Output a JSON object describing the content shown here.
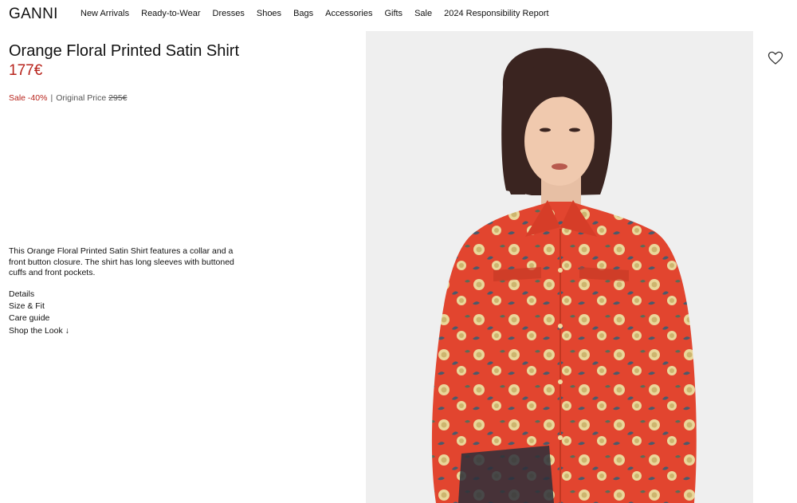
{
  "brand": {
    "logo_text": "GANNI"
  },
  "nav": {
    "items": [
      {
        "label": "New Arrivals"
      },
      {
        "label": "Ready-to-Wear"
      },
      {
        "label": "Dresses"
      },
      {
        "label": "Shoes"
      },
      {
        "label": "Bags"
      },
      {
        "label": "Accessories"
      },
      {
        "label": "Gifts"
      },
      {
        "label": "Sale"
      },
      {
        "label": "2024 Responsibility Report"
      }
    ]
  },
  "product": {
    "title": "Orange Floral Printed Satin Shirt",
    "price": "177€",
    "sale_label": "Sale -40%",
    "separator": "|",
    "original_price_label": "Original Price ",
    "original_price": "295€",
    "description": "This Orange Floral Printed Satin Shirt features a collar and a front button closure. The shirt has long sleeves with buttoned cuffs and front pockets.",
    "links": [
      {
        "label": "Details"
      },
      {
        "label": "Size & Fit"
      },
      {
        "label": "Care guide"
      },
      {
        "label": "Shop the Look ↓"
      }
    ]
  },
  "icons": {
    "wishlist": "heart-outline-icon"
  },
  "colors": {
    "sale_red": "#b8241c",
    "shirt_orange": "#e2452f",
    "image_background": "#efefef"
  }
}
